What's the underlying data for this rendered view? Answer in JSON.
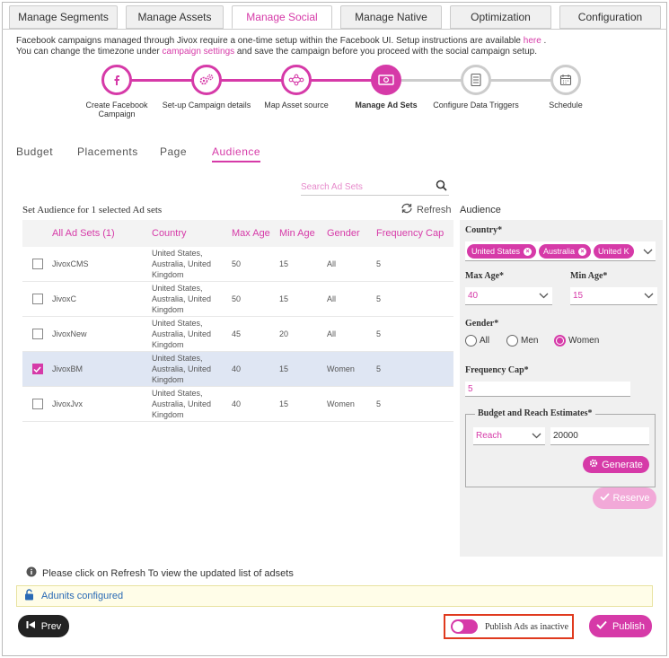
{
  "tabs": [
    "Manage Segments",
    "Manage Assets",
    "Manage Social",
    "Manage Native",
    "Optimization",
    "Configuration"
  ],
  "active_tab": "Manage Social",
  "info": {
    "line1_pre": "Facebook campaigns managed through Jivox require a one-time setup within the Facebook UI. Setup instructions are available ",
    "line1_link": "here",
    "line1_post": " .",
    "line2_pre": "You can change the timezone under ",
    "line2_link": "campaign settings",
    "line2_post": " and save the campaign before you proceed with the social campaign setup."
  },
  "steps": [
    {
      "label": "Create Facebook Campaign",
      "icon": "facebook-icon",
      "state": "done"
    },
    {
      "label": "Set-up Campaign details",
      "icon": "gears-icon",
      "state": "done"
    },
    {
      "label": "Map Asset source",
      "icon": "share-nodes-icon",
      "state": "done"
    },
    {
      "label": "Manage Ad Sets",
      "icon": "money-icon",
      "state": "current"
    },
    {
      "label": "Configure Data Triggers",
      "icon": "list-icon",
      "state": "todo"
    },
    {
      "label": "Schedule",
      "icon": "calendar-icon",
      "state": "todo"
    }
  ],
  "subtabs": [
    "Budget",
    "Placements",
    "Page",
    "Audience"
  ],
  "active_subtab": "Audience",
  "search": {
    "placeholder": "Search Ad Sets"
  },
  "set_audience_label": "Set Audience for 1 selected Ad sets",
  "refresh_label": "Refresh",
  "table": {
    "headers": [
      "All Ad Sets (1)",
      "Country",
      "Max Age",
      "Min Age",
      "Gender",
      "Frequency Cap"
    ],
    "rows": [
      {
        "name": "JivoxCMS",
        "country": "United States, Australia, United Kingdom",
        "max": "50",
        "min": "15",
        "gender": "All",
        "freq": "5",
        "checked": false
      },
      {
        "name": "JivoxC",
        "country": "United States, Australia, United Kingdom",
        "max": "50",
        "min": "15",
        "gender": "All",
        "freq": "5",
        "checked": false
      },
      {
        "name": "JivoxNew",
        "country": "United States, Australia, United Kingdom",
        "max": "45",
        "min": "20",
        "gender": "All",
        "freq": "5",
        "checked": false
      },
      {
        "name": "JivoxBM",
        "country": "United States, Australia, United Kingdom",
        "max": "40",
        "min": "15",
        "gender": "Women",
        "freq": "5",
        "checked": true
      },
      {
        "name": "JivoxJvx",
        "country": "United States, Australia, United Kingdom",
        "max": "40",
        "min": "15",
        "gender": "Women",
        "freq": "5",
        "checked": false
      }
    ]
  },
  "audience": {
    "title": "Audience",
    "country_label": "Country*",
    "countries": [
      "United States",
      "Australia",
      "United K"
    ],
    "max_age_label": "Max Age*",
    "max_age": "40",
    "min_age_label": "Min Age*",
    "min_age": "15",
    "gender_label": "Gender*",
    "gender_options": [
      "All",
      "Men",
      "Women"
    ],
    "gender_selected": "Women",
    "freq_label": "Frequency Cap*",
    "freq": "5",
    "budget_legend": "Budget and Reach Estimates*",
    "estimate_type": "Reach",
    "estimate_value": "20000",
    "generate_label": "Generate",
    "reserve_label": "Reserve"
  },
  "note": "Please click on Refresh To view the updated list of adsets",
  "adunits_label": "Adunits configured",
  "prev_label": "Prev",
  "publish_inactive_label": "Publish Ads as inactive",
  "publish_label": "Publish",
  "colors": {
    "accent": "#d63aa8",
    "selected_row": "#dfe6f3",
    "link": "#2a6ab5"
  }
}
